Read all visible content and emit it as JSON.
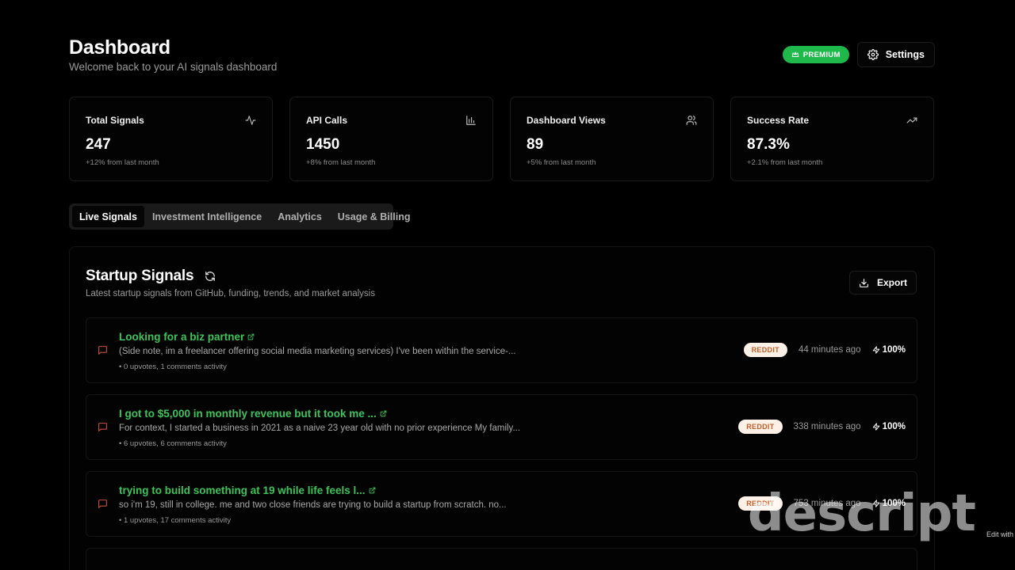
{
  "header": {
    "title": "Dashboard",
    "subtitle": "Welcome back to your AI signals dashboard",
    "premium_label": "PREMIUM",
    "settings_label": "Settings"
  },
  "stats": [
    {
      "label": "Total Signals",
      "value": "247",
      "change": "+12% from last month",
      "icon": "activity-icon"
    },
    {
      "label": "API Calls",
      "value": "1450",
      "change": "+8% from last month",
      "icon": "bar-chart-icon"
    },
    {
      "label": "Dashboard Views",
      "value": "89",
      "change": "+5% from last month",
      "icon": "users-icon"
    },
    {
      "label": "Success Rate",
      "value": "87.3%",
      "change": "+2.1% from last month",
      "icon": "trending-up-icon"
    }
  ],
  "tabs": [
    {
      "label": "Live Signals",
      "active": true
    },
    {
      "label": "Investment Intelligence",
      "active": false
    },
    {
      "label": "Analytics",
      "active": false
    },
    {
      "label": "Usage & Billing",
      "active": false
    }
  ],
  "panel": {
    "title": "Startup Signals",
    "subtitle": "Latest startup signals from GitHub, funding, trends, and market analysis",
    "export_label": "Export"
  },
  "signals": [
    {
      "title": "Looking for a biz partner",
      "description": "(Side note, im a freelancer offering social media marketing services) I've been within the service-...",
      "meta": "• 0 upvotes, 1 comments activity",
      "source": "REDDIT",
      "time": "44 minutes ago",
      "score": "100%"
    },
    {
      "title": "I got to $5,000 in monthly revenue but it took me ...",
      "description": "For context, I started a business in 2021 as a naive 23 year old with no prior experience My family...",
      "meta": "• 6 upvotes, 6 comments activity",
      "source": "REDDIT",
      "time": "338 minutes ago",
      "score": "100%"
    },
    {
      "title": "trying to build something at 19 while life feels l...",
      "description": "so i'm 19, still in college. me and two close friends are trying to build a startup from scratch. no...",
      "meta": "• 1 upvotes, 17 comments activity",
      "source": "REDDIT",
      "time": "753 minutes ago",
      "score": "100%"
    }
  ],
  "colors": {
    "accent_green": "#3ec35a",
    "premium_green": "#1fb84a",
    "reddit_badge_bg": "#fdf0e6",
    "reddit_badge_text": "#c0602a",
    "signal_icon": "#c9503a"
  },
  "watermark": {
    "brand": "descript",
    "edit_text": "Edit with"
  }
}
